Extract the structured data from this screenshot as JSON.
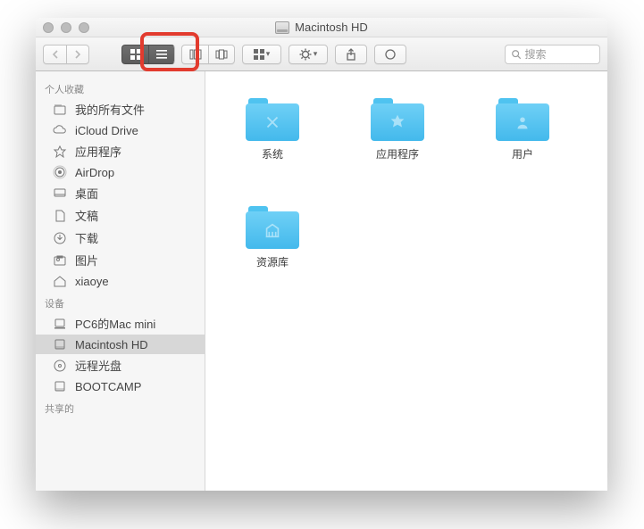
{
  "window": {
    "title": "Macintosh HD"
  },
  "search": {
    "placeholder": "搜索"
  },
  "sidebar": {
    "sections": [
      {
        "header": "个人收藏",
        "items": [
          {
            "label": "我的所有文件",
            "icon": "all-files"
          },
          {
            "label": "iCloud Drive",
            "icon": "icloud"
          },
          {
            "label": "应用程序",
            "icon": "applications"
          },
          {
            "label": "AirDrop",
            "icon": "airdrop"
          },
          {
            "label": "桌面",
            "icon": "desktop"
          },
          {
            "label": "文稿",
            "icon": "documents"
          },
          {
            "label": "下载",
            "icon": "downloads"
          },
          {
            "label": "图片",
            "icon": "pictures"
          },
          {
            "label": "xiaoye",
            "icon": "home"
          }
        ]
      },
      {
        "header": "设备",
        "items": [
          {
            "label": "PC6的Mac mini",
            "icon": "computer"
          },
          {
            "label": "Macintosh HD",
            "icon": "hdd",
            "selected": true
          },
          {
            "label": "远程光盘",
            "icon": "disc"
          },
          {
            "label": "BOOTCAMP",
            "icon": "hdd-alt"
          }
        ]
      },
      {
        "header": "共享的",
        "items": []
      }
    ]
  },
  "folders": [
    {
      "label": "系统",
      "glyph": "system"
    },
    {
      "label": "应用程序",
      "glyph": "apps"
    },
    {
      "label": "用户",
      "glyph": "users"
    },
    {
      "label": "资源库",
      "glyph": "library"
    }
  ]
}
